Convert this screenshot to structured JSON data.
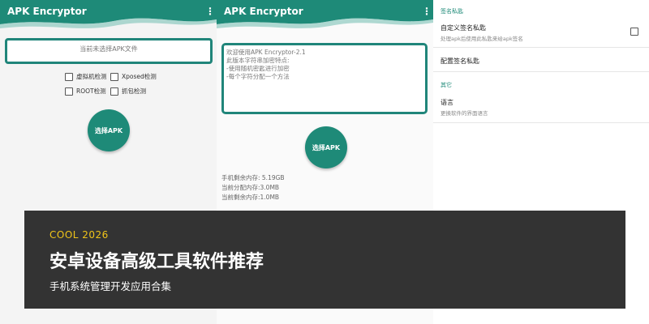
{
  "colors": {
    "accent": "#1e8a78",
    "banner_bg": "#333333",
    "banner_tag": "#f0c419"
  },
  "panel1": {
    "title": "APK Encryptor",
    "menu_icon": "⋮",
    "file_placeholder": "当前未选择APK文件",
    "checks": [
      {
        "label": "虚拟机检测"
      },
      {
        "label": "Xposed检测"
      },
      {
        "label": "ROOT检测"
      },
      {
        "label": "抓包检测"
      }
    ],
    "select_button": "选择APK"
  },
  "panel2": {
    "title": "APK Encryptor",
    "menu_icon": "⋮",
    "log_lines": [
      "欢迎使用APK Encryptor-2.1",
      "此版本字符串加密特点:",
      "-使用随机密匙进行加密",
      "-每个字符分配一个方法"
    ],
    "select_button": "选择APK",
    "memory": [
      "手机剩余内存: 5.19GB",
      "当前分配内存:3.0MB",
      "当前剩余内存:1.0MB"
    ]
  },
  "panel3": {
    "section_signing": "签名私匙",
    "custom_key_title": "自定义签名私匙",
    "custom_key_sub": "处理apk后使用此私匙来给apk签名",
    "config_key_title": "配置签名私匙",
    "section_other": "其它",
    "language_title": "语言",
    "language_sub": "更换软件的界面语言"
  },
  "banner": {
    "tag": "COOL 2026",
    "headline": "安卓设备高级工具软件推荐",
    "subline": "手机系统管理开发应用合集"
  }
}
